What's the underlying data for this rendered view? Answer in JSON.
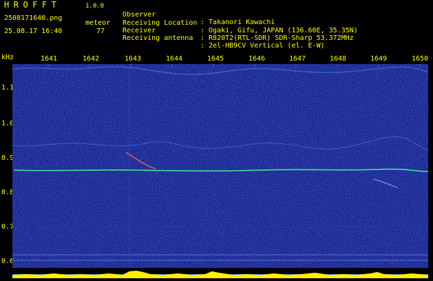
{
  "header": {
    "app_name": "HROFFT",
    "app_version": "1.0.0",
    "filename": "2508171640.png",
    "datetime": "25.08.17 16:40",
    "meteor_label": "meteor",
    "meteor_count": "77"
  },
  "info": [
    {
      "key": "Observer",
      "value": ": Takanori Kawachi"
    },
    {
      "key": "Receiving Location",
      "value": ": Ogaki, Gifu, JAPAN (136.60E, 35.35N)"
    },
    {
      "key": "Receiver",
      "value": ": R820T2(RTL-SDR) SDR-Sharp 53.372MHz"
    },
    {
      "key": "Receiving antenna",
      "value": ": 2el-HB9CV Vertical (el. E-W)"
    }
  ],
  "axis": {
    "y_unit": "kHz",
    "y_ticks": [
      "1.1",
      "1.0",
      "0.9",
      "0.8",
      "0.7",
      "0.6"
    ],
    "x_ticks": [
      "1641",
      "1642",
      "1643",
      "1644",
      "1645",
      "1646",
      "1647",
      "1648",
      "1649",
      "1650"
    ]
  },
  "colors": {
    "background": "#000000",
    "label": "#ffff00",
    "spectrogram_bg": "#121f8a",
    "signal": "#40ff90"
  }
}
